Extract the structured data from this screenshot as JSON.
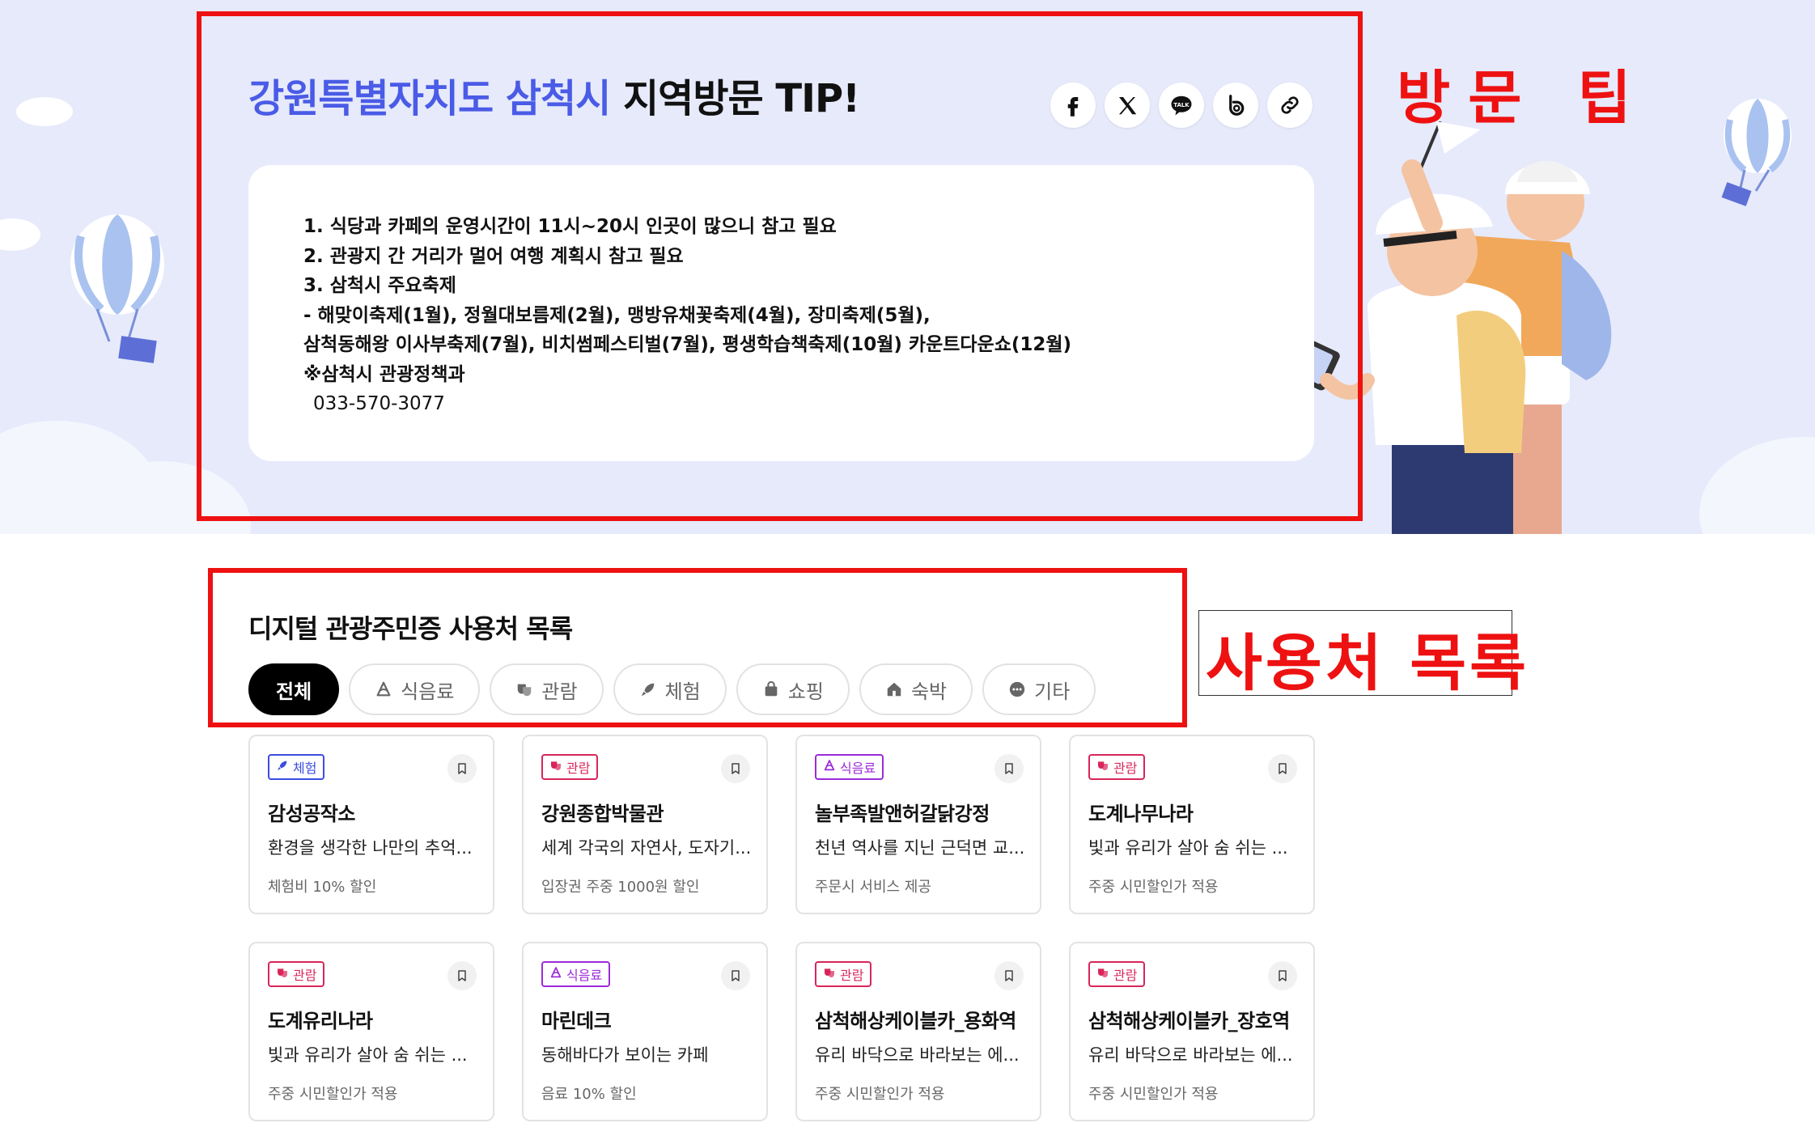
{
  "tip": {
    "title_highlight": "강원특별자치도 삼척시",
    "title_rest": " 지역방문 TIP!",
    "lines": [
      "1. 식당과 카페의 운영시간이 11시~20시 인곳이 많으니 참고 필요",
      "2. 관광지 간 거리가 멀어 여행 계획시 참고 필요",
      "3. 삼척시 주요축제",
      "- 해맞이축제(1월), 정월대보름제(2월), 맹방유채꽃축제(4월), 장미축제(5월),",
      "삼척동해왕 이사부축제(7월), 비치썸페스티벌(7월), 평생학습책축제(10월) 카운트다운쇼(12월)",
      "※삼척시 관광정책과"
    ],
    "phone": "033-570-3077",
    "share": [
      {
        "icon": "facebook-icon"
      },
      {
        "icon": "x-icon"
      },
      {
        "icon": "kakaotalk-icon",
        "label": "TALK"
      },
      {
        "icon": "band-icon"
      },
      {
        "icon": "link-icon"
      }
    ]
  },
  "annotations": {
    "tip_label": "방문 팁",
    "list_label": "사용처 목록",
    "color": "#ee1111"
  },
  "list": {
    "title": "디지털 관광주민증 사용처 목록",
    "tabs": [
      {
        "label": "전체",
        "active": true
      },
      {
        "label": "식음료",
        "icon": "food-icon"
      },
      {
        "label": "관람",
        "icon": "mask-icon"
      },
      {
        "label": "체험",
        "icon": "rocket-icon"
      },
      {
        "label": "쇼핑",
        "icon": "bag-icon"
      },
      {
        "label": "숙박",
        "icon": "house-icon"
      },
      {
        "label": "기타",
        "icon": "more-icon"
      }
    ],
    "cards": [
      {
        "category": "체험",
        "type": "exp",
        "name": "감성공작소",
        "desc": "환경을 생각한 나만의 추억...",
        "benefit": "체험비 10% 할인"
      },
      {
        "category": "관람",
        "type": "tour",
        "name": "강원종합박물관",
        "desc": "세계 각국의 자연사, 도자기...",
        "benefit": "입장권 주중 1000원 할인"
      },
      {
        "category": "식음료",
        "type": "food",
        "name": "놀부족발앤허갈닭강정",
        "desc": "천년 역사를 지닌 근덕면 교...",
        "benefit": "주문시 서비스 제공"
      },
      {
        "category": "관람",
        "type": "tour",
        "name": "도계나무나라",
        "desc": "빛과 유리가 살아 숨 쉬는 ...",
        "benefit": "주중 시민할인가 적용"
      },
      {
        "category": "관람",
        "type": "tour",
        "name": "도계유리나라",
        "desc": "빛과 유리가 살아 숨 쉬는 ...",
        "benefit": "주중 시민할인가 적용"
      },
      {
        "category": "식음료",
        "type": "food",
        "name": "마린데크",
        "desc": "동해바다가 보이는 카페",
        "benefit": "음료 10% 할인"
      },
      {
        "category": "관람",
        "type": "tour",
        "name": "삼척해상케이블카_용화역",
        "desc": "유리 바닥으로 바라보는 에...",
        "benefit": "주중 시민할인가 적용"
      },
      {
        "category": "관람",
        "type": "tour",
        "name": "삼척해상케이블카_장호역",
        "desc": "유리 바닥으로 바라보는 에...",
        "benefit": "주중 시민할인가 적용"
      }
    ]
  },
  "colors": {
    "accent": "#4a5be6",
    "hero_bg": "#e6eafb"
  }
}
